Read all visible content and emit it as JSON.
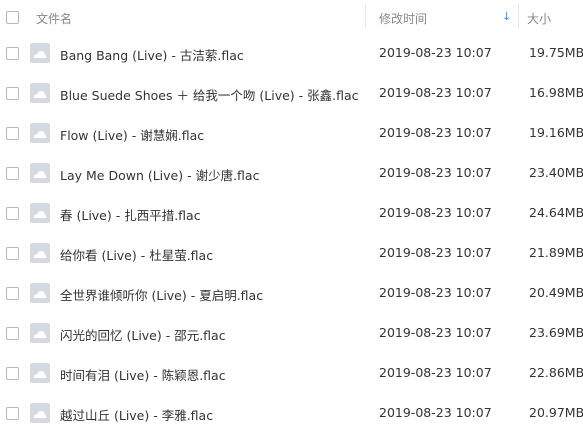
{
  "header": {
    "name_label": "文件名",
    "date_label": "修改时间",
    "size_label": "大小",
    "sort_icon": "arrow-down-icon",
    "sort_color": "#3b8cff"
  },
  "files": [
    {
      "name": "Bang Bang (Live) - 古洁萦.flac",
      "modified": "2019-08-23 10:07",
      "size": "19.75MB"
    },
    {
      "name": "Blue Suede Shoes ＋ 给我一个吻 (Live) - 张鑫.flac",
      "modified": "2019-08-23 10:07",
      "size": "16.98MB"
    },
    {
      "name": "Flow (Live) - 谢慧娴.flac",
      "modified": "2019-08-23 10:07",
      "size": "19.16MB"
    },
    {
      "name": "Lay Me Down (Live) - 谢少唐.flac",
      "modified": "2019-08-23 10:07",
      "size": "23.40MB"
    },
    {
      "name": "春 (Live) - 扎西平措.flac",
      "modified": "2019-08-23 10:07",
      "size": "24.64MB"
    },
    {
      "name": "给你看 (Live) - 杜星萤.flac",
      "modified": "2019-08-23 10:07",
      "size": "21.89MB"
    },
    {
      "name": "全世界谁倾听你 (Live) - 夏启明.flac",
      "modified": "2019-08-23 10:07",
      "size": "20.49MB"
    },
    {
      "name": "闪光的回忆 (Live) - 邵元.flac",
      "modified": "2019-08-23 10:07",
      "size": "23.69MB"
    },
    {
      "name": "时间有泪 (Live) - 陈颖恩.flac",
      "modified": "2019-08-23 10:07",
      "size": "22.86MB"
    },
    {
      "name": "越过山丘 (Live) - 李雅.flac",
      "modified": "2019-08-23 10:07",
      "size": "20.97MB"
    }
  ]
}
